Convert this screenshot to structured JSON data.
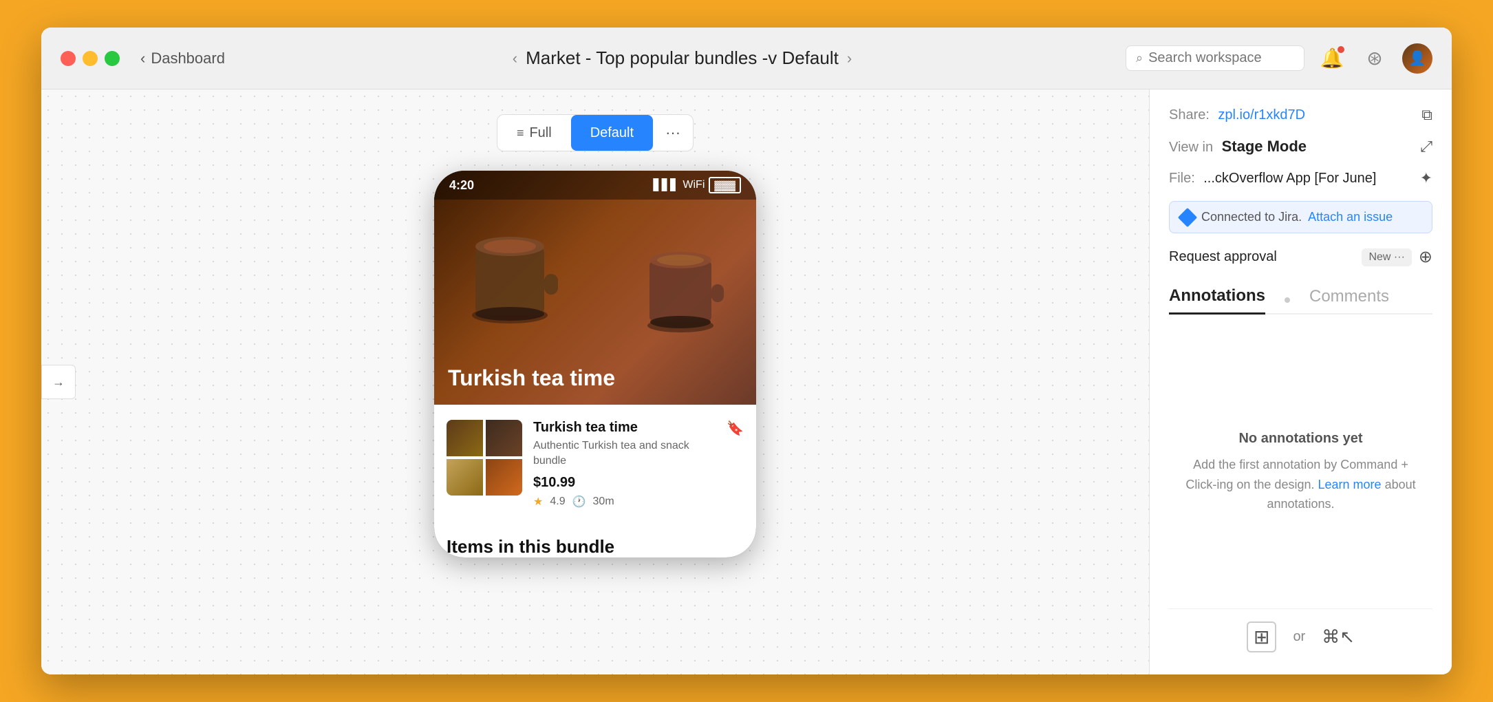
{
  "window": {
    "title": "Market - Top popular bundles -v Default"
  },
  "titlebar": {
    "back_label": "Dashboard",
    "page_title": "Market - Top popular bundles -v Default",
    "search_placeholder": "Search workspace"
  },
  "view_controls": {
    "layers_label": "Full",
    "default_label": "Default",
    "dots_label": "···"
  },
  "device": {
    "status_time": "4:20",
    "hero_title": "Turkish tea time",
    "product_name": "Turkish tea time",
    "product_desc": "Authentic Turkish tea and snack bundle",
    "product_price": "$10.99",
    "product_rating": "4.9",
    "product_delivery": "30m",
    "items_section_title": "Items in this bundle"
  },
  "right_panel": {
    "share_label": "Share:",
    "share_link": "zpl.io/r1xkd7D",
    "view_label": "View in",
    "stage_mode": "Stage Mode",
    "file_label": "File:",
    "file_value": "...ckOverflow App [For June]",
    "jira_text": "Connected to Jira.",
    "jira_attach": "Attach an issue",
    "request_approval_label": "Request approval",
    "approval_badge": "New ···",
    "annotations_tab": "Annotations",
    "comments_tab": "Comments",
    "no_annotations": "No annotations yet",
    "annotations_hint_1": "Add the first annotation by Command + Click-ing on the design.",
    "learn_more": "Learn more",
    "annotations_hint_2": "about annotations.",
    "or_label": "or"
  },
  "icons": {
    "close": "●",
    "minimize": "●",
    "maximize": "●",
    "back_arrow": "‹",
    "forward_arrow": "›",
    "search": "⌕",
    "notification": "🔔",
    "help": "⊕",
    "copy": "⧉",
    "expand": "⤢",
    "figma": "✦",
    "plus": "⊕",
    "add_annotation": "⊞",
    "cmd_shortcut": "⌘↖"
  }
}
